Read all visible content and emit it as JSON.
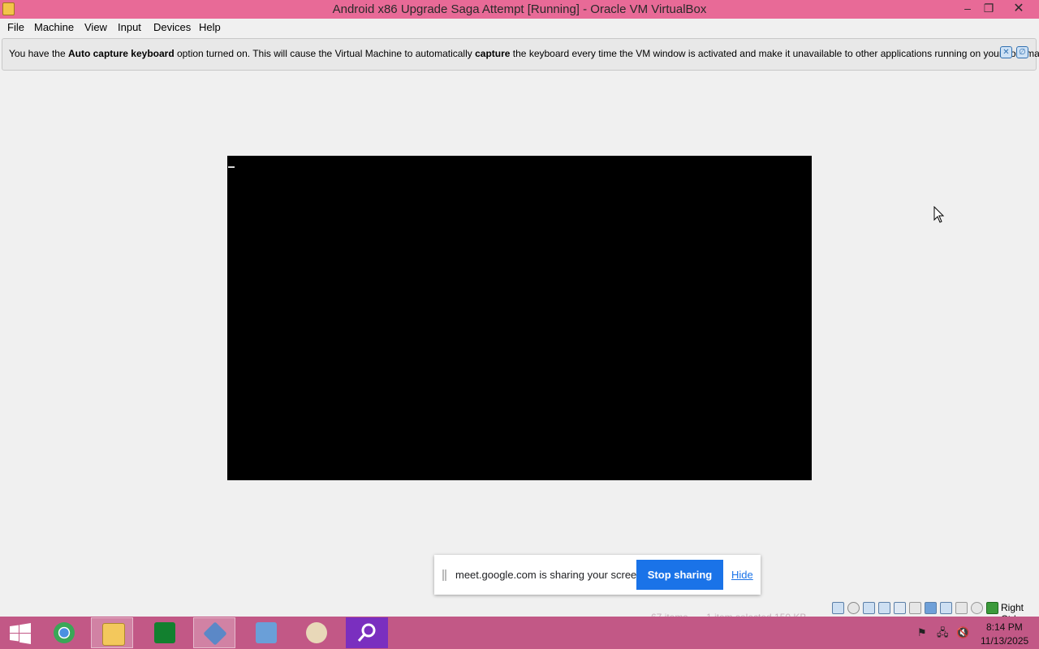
{
  "window": {
    "title": "Android x86 Upgrade Saga Attempt [Running] - Oracle VM VirtualBox",
    "minimize_glyph": "–",
    "maximize_glyph": "❐",
    "close_glyph": "✕"
  },
  "menu": {
    "items": [
      "File",
      "Machine",
      "View",
      "Input",
      "Devices",
      "Help"
    ]
  },
  "banner": {
    "part1": "You have the ",
    "bold1": "Auto capture keyboard",
    "part2": " option turned on. This will cause the Virtual Machine to automatically ",
    "bold2": "capture",
    "part3": " the keyboard every time the VM window is activated and make it unavailable to other applications running on your host machine:"
  },
  "share_bar": {
    "message": "meet.google.com is sharing your screen.",
    "stop_label": "Stop sharing",
    "hide_label": "Hide"
  },
  "status": {
    "host_key": "Right Ctrl",
    "icons": [
      "hard-disk-icon",
      "optical-drive-icon",
      "audio-icon",
      "network-icon",
      "usb-icon",
      "shared-folders-icon",
      "display-icon",
      "video-capture-icon",
      "recording-icon",
      "cpu-icon",
      "mouse-integration-icon",
      "keyboard-capture-icon"
    ]
  },
  "taskbar": {
    "apps": [
      "windows-start",
      "chrome",
      "file-explorer",
      "store",
      "virtualbox",
      "remote-desktop",
      "paint",
      "search"
    ],
    "ghost_items": "67 items",
    "ghost_selected": "1 item selected  150 KB",
    "time": "8:14 PM",
    "date": "11/13/2025"
  },
  "colors": {
    "titlebar": "#e86a97",
    "taskbar": "#c25886",
    "stop_button": "#1a73e8"
  }
}
